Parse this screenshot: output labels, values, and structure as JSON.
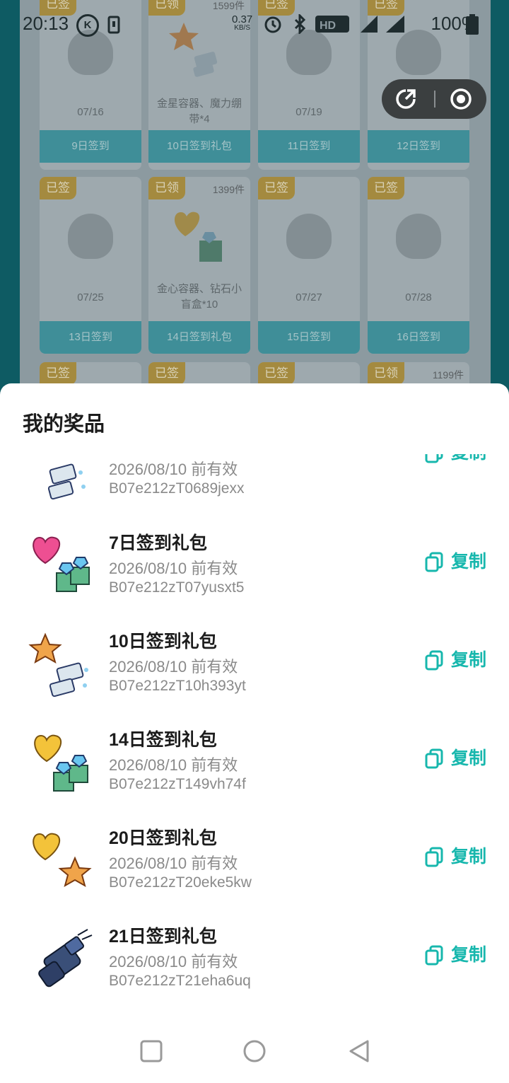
{
  "status_bar": {
    "time": "20:13",
    "k_badge": "K",
    "speed_value": "0.37",
    "speed_unit": "KB/S",
    "battery": "100%"
  },
  "background_grid": {
    "cards": [
      {
        "badge": "已签",
        "date": "07/16",
        "footer": "9日签到",
        "count": "",
        "desc": ""
      },
      {
        "badge": "已领",
        "date": "",
        "footer": "10日签到礼包",
        "count": "1599件",
        "desc": "金星容器、魔力绷带*4"
      },
      {
        "badge": "已签",
        "date": "07/19",
        "footer": "11日签到",
        "count": "",
        "desc": ""
      },
      {
        "badge": "已签",
        "date": "",
        "footer": "12日签到",
        "count": "",
        "desc": ""
      },
      {
        "badge": "已签",
        "date": "07/25",
        "footer": "13日签到",
        "count": "",
        "desc": ""
      },
      {
        "badge": "已领",
        "date": "",
        "footer": "14日签到礼包",
        "count": "1399件",
        "desc": "金心容器、钻石小盲盒*10"
      },
      {
        "badge": "已签",
        "date": "07/27",
        "footer": "15日签到",
        "count": "",
        "desc": ""
      },
      {
        "badge": "已签",
        "date": "07/28",
        "footer": "16日签到",
        "count": "",
        "desc": ""
      },
      {
        "badge": "已签",
        "date": "",
        "footer": "",
        "count": "",
        "desc": ""
      },
      {
        "badge": "已签",
        "date": "",
        "footer": "",
        "count": "",
        "desc": ""
      },
      {
        "badge": "已签",
        "date": "",
        "footer": "",
        "count": "",
        "desc": ""
      },
      {
        "badge": "已领",
        "date": "",
        "footer": "",
        "count": "1199件",
        "desc": ""
      }
    ]
  },
  "sheet": {
    "title": "我的奖品",
    "copy_label": "复制",
    "prizes": [
      {
        "name": "",
        "valid": "2026/08/10 前有效",
        "code": "B07e212zT0689jexx",
        "icon": "star-bandage-icon"
      },
      {
        "name": "7日签到礼包",
        "valid": "2026/08/10 前有效",
        "code": "B07e212zT07yusxt5",
        "icon": "pink-heart-gift-icon"
      },
      {
        "name": "10日签到礼包",
        "valid": "2026/08/10 前有效",
        "code": "B07e212zT10h393yt",
        "icon": "gold-star-bandage-icon"
      },
      {
        "name": "14日签到礼包",
        "valid": "2026/08/10 前有效",
        "code": "B07e212zT149vh74f",
        "icon": "gold-heart-gift-icon"
      },
      {
        "name": "20日签到礼包",
        "valid": "2026/08/10 前有效",
        "code": "B07e212zT20eke5kw",
        "icon": "gold-heart-star-icon"
      },
      {
        "name": "21日签到礼包",
        "valid": "2026/08/10 前有效",
        "code": "B07e212zT21eha6uq",
        "icon": "armor-gauntlet-icon"
      }
    ]
  },
  "colors": {
    "accent": "#17b7ad",
    "sheet_bg": "#ffffff",
    "page_bg": "#0e5b63"
  }
}
